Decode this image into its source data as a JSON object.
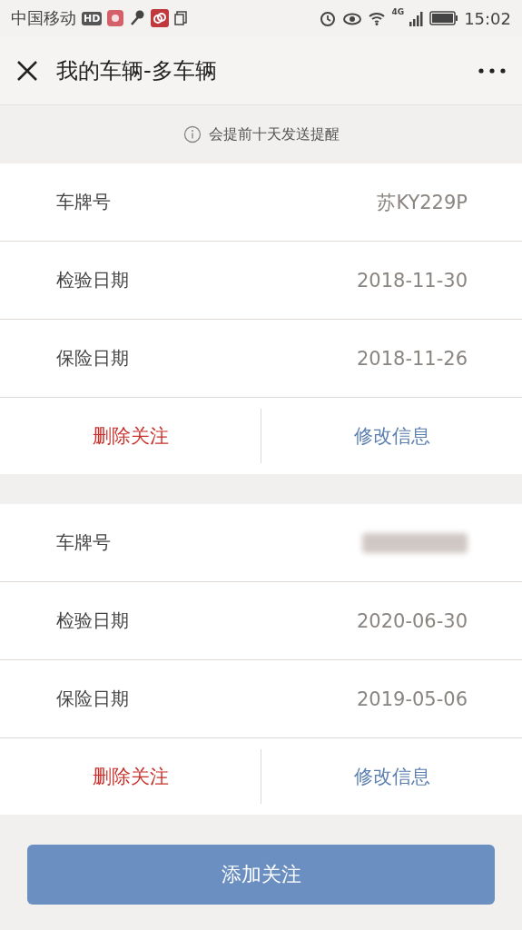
{
  "status_bar": {
    "carrier": "中国移动",
    "hd_badge": "HD",
    "network": "4G",
    "time": "15:02"
  },
  "header": {
    "title": "我的车辆-多车辆"
  },
  "notice": "会提前十天发送提醒",
  "vehicles": [
    {
      "fields": [
        {
          "kind": "text",
          "label": "车牌号",
          "value": "苏KY229P"
        },
        {
          "kind": "text",
          "label": "检验日期",
          "value": "2018-11-30"
        },
        {
          "kind": "text",
          "label": "保险日期",
          "value": "2018-11-26"
        }
      ],
      "actions": [
        "删除关注",
        "修改信息"
      ]
    },
    {
      "fields": [
        {
          "kind": "blurred",
          "label": "车牌号"
        },
        {
          "kind": "text",
          "label": "检验日期",
          "value": "2020-06-30"
        },
        {
          "kind": "text",
          "label": "保险日期",
          "value": "2019-05-06"
        }
      ],
      "actions": [
        "删除关注",
        "修改信息"
      ]
    }
  ],
  "add_button": "添加关注"
}
